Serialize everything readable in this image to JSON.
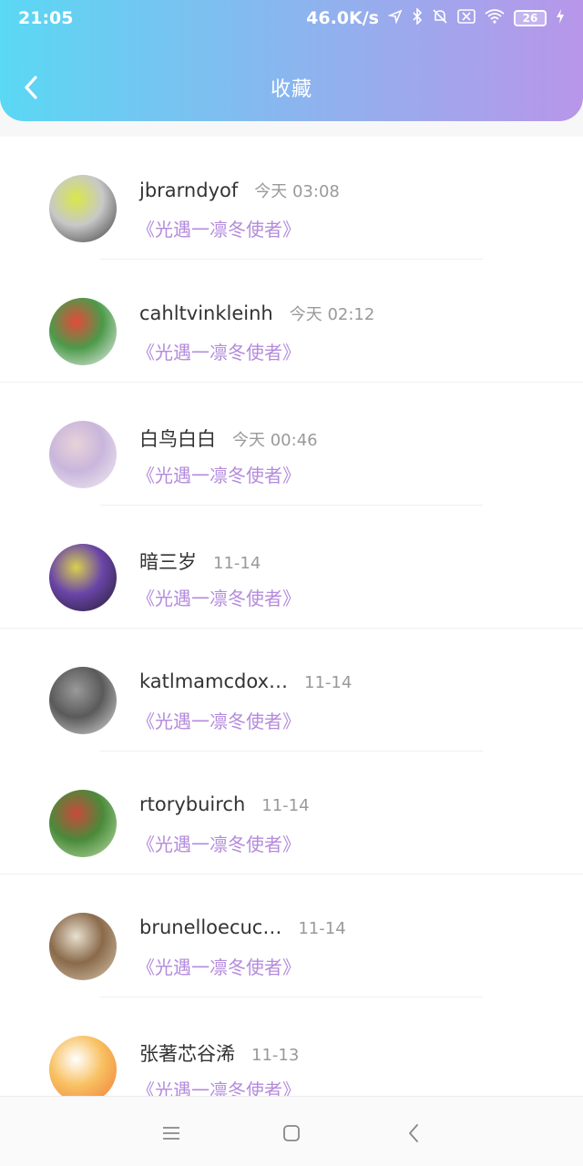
{
  "status_bar": {
    "time": "21:05",
    "network_speed": "46.0K/s",
    "battery": "26",
    "icons": [
      "location-icon",
      "bluetooth-icon",
      "mute-icon",
      "sim-icon",
      "wifi-icon",
      "battery-icon",
      "charging-icon"
    ]
  },
  "header": {
    "title": "收藏",
    "back_icon": "back-chevron-icon"
  },
  "favorites": [
    {
      "name": "jbrarndyof",
      "time": "今天 03:08",
      "work": "《光遇一凛冬使者》",
      "avatar_colors": [
        "#3a3a3a",
        "#c8c8c8",
        "#d8e84a"
      ]
    },
    {
      "name": "cahltvinkleinh",
      "time": "今天 02:12",
      "work": "《光遇一凛冬使者》",
      "avatar_colors": [
        "#f2f2f2",
        "#4c9a4a",
        "#e44a3a"
      ]
    },
    {
      "name": "白鸟白白",
      "time": "今天 00:46",
      "work": "《光遇一凛冬使者》",
      "avatar_colors": [
        "#f3eef3",
        "#c9b6dc",
        "#e8d2d8"
      ]
    },
    {
      "name": "暗三岁",
      "time": "11-14",
      "work": "《光遇一凛冬使者》",
      "avatar_colors": [
        "#241c2e",
        "#6a45a8",
        "#d8d050"
      ]
    },
    {
      "name": "katlmamcdox…",
      "time": "11-14",
      "work": "《光遇一凛冬使者》",
      "avatar_colors": [
        "#dcdcdc",
        "#5a5a5a",
        "#9a9a9a"
      ]
    },
    {
      "name": "rtorybuirch",
      "time": "11-14",
      "work": "《光遇一凛冬使者》",
      "avatar_colors": [
        "#bde0a8",
        "#4a8a3a",
        "#c84a3a"
      ]
    },
    {
      "name": "brunelloecuc…",
      "time": "11-14",
      "work": "《光遇一凛冬使者》",
      "avatar_colors": [
        "#d8c8b0",
        "#8a6a4a",
        "#e8e0d0"
      ]
    },
    {
      "name": "张著芯谷浠",
      "time": "11-13",
      "work": "《光遇一凛冬使者》",
      "avatar_colors": [
        "#f07a3a",
        "#f8c060",
        "#ffffff"
      ]
    }
  ],
  "bottom_nav": {
    "icons": [
      "menu-icon",
      "home-icon",
      "back-icon"
    ]
  },
  "colors": {
    "header_gradient_start": "#5ad8f4",
    "header_gradient_end": "#b896ea",
    "work_title_color": "#b48bdc",
    "time_color": "#9a9a9a"
  }
}
